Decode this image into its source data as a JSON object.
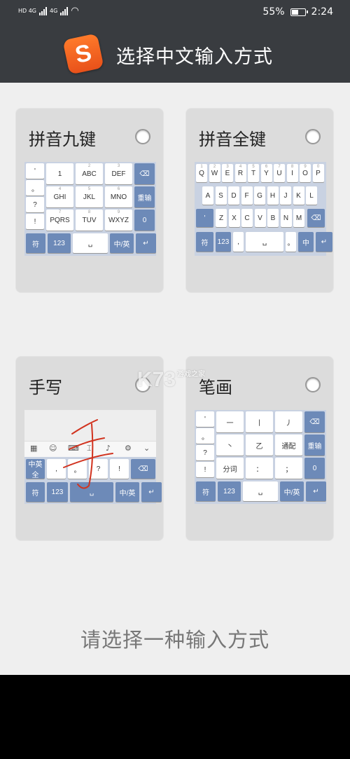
{
  "status_bar": {
    "network_left": "HD 4G",
    "network_right": "4G",
    "battery_percent": "55%",
    "battery_level": 0.55,
    "time": "2:24"
  },
  "header": {
    "logo_letter": "S",
    "title": "选择中文输入方式"
  },
  "options": [
    {
      "label": "拼音九键",
      "selected": false
    },
    {
      "label": "拼音全键",
      "selected": false
    },
    {
      "label": "手写",
      "selected": false
    },
    {
      "label": "笔画",
      "selected": false
    }
  ],
  "keyboards": {
    "pinyin9": {
      "left_column": [
        "'",
        "。",
        "?",
        "!"
      ],
      "rows": [
        [
          "1",
          "ABC",
          "DEF"
        ],
        [
          "GHI",
          "JKL",
          "MNO"
        ],
        [
          "PQRS",
          "TUV",
          "WXYZ"
        ]
      ],
      "row_sublabels": [
        [
          "",
          "2",
          "3"
        ],
        [
          "4",
          "5",
          "6"
        ],
        [
          "7",
          "8",
          "9"
        ]
      ],
      "right_column": [
        "⌫",
        "重输",
        "0"
      ],
      "bottom": [
        "符",
        "123",
        "␣",
        "中/英",
        "↵"
      ]
    },
    "qwerty": {
      "row1": [
        "Q",
        "W",
        "E",
        "R",
        "T",
        "Y",
        "U",
        "I",
        "O",
        "P"
      ],
      "row2": [
        "A",
        "S",
        "D",
        "F",
        "G",
        "H",
        "J",
        "K",
        "L"
      ],
      "row3": [
        "Z",
        "X",
        "C",
        "V",
        "B",
        "N",
        "M"
      ],
      "row3_left": "'",
      "row3_right": "⌫",
      "bottom": [
        "符",
        "123",
        ",",
        "␣",
        "。",
        "中",
        "↵"
      ]
    },
    "handwrite": {
      "toolbar_icons": [
        "grid-icon",
        "emoji-icon",
        "keyboard-icon",
        "cursor-icon",
        "mic-icon",
        "gear-icon",
        "chevron-down-icon"
      ],
      "row1": [
        "中英全",
        ",",
        "。",
        "?",
        "!",
        "⌫"
      ],
      "bottom": [
        "符",
        "123",
        "␣",
        "中/英",
        "↵"
      ]
    },
    "stroke": {
      "left_column": [
        "'",
        "。",
        "?",
        "!"
      ],
      "rows": [
        [
          "一",
          "丨",
          "丿"
        ],
        [
          "丶",
          "乙",
          "通配"
        ],
        [
          "分词",
          "：",
          "；"
        ]
      ],
      "right_column": [
        "⌫",
        "重输",
        "0"
      ],
      "bottom": [
        "符",
        "123",
        "␣",
        "中/英",
        "↵"
      ]
    }
  },
  "footer_prompt": "请选择一种输入方式",
  "watermark": {
    "text": "K73",
    "sub": "游戏之家"
  }
}
